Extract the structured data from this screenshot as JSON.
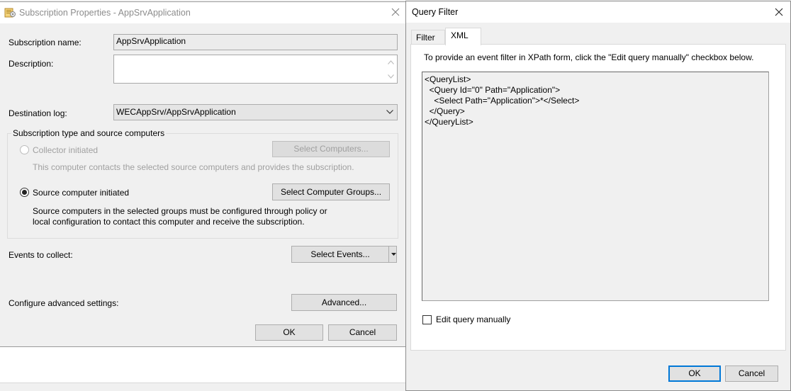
{
  "subscription_dialog": {
    "title": "Subscription Properties - AppSrvApplication",
    "name_label": "Subscription name:",
    "name_value": "AppSrvApplication",
    "description_label": "Description:",
    "description_value": "",
    "destination_label": "Destination log:",
    "destination_value": "WECAppSrv/AppSrvApplication",
    "group_title": "Subscription type and source computers",
    "collector_initiated": {
      "label": "Collector initiated",
      "button": "Select Computers...",
      "description": "This computer contacts the selected source computers and provides the subscription.",
      "selected": false,
      "enabled": false
    },
    "source_initiated": {
      "label": "Source computer initiated",
      "button": "Select Computer Groups...",
      "description_line1": "Source computers in the selected groups must be configured through policy or",
      "description_line2": "local configuration to contact this computer and receive the subscription.",
      "selected": true
    },
    "events_label": "Events to collect:",
    "events_button": "Select Events...",
    "advanced_label": "Configure advanced settings:",
    "advanced_button": "Advanced...",
    "ok_button": "OK",
    "cancel_button": "Cancel"
  },
  "query_filter_dialog": {
    "title": "Query Filter",
    "tabs": [
      {
        "label": "Filter",
        "active": false
      },
      {
        "label": "XML",
        "active": true
      }
    ],
    "instruction": "To provide an event filter in XPath form, click the \"Edit query manually\" checkbox below.",
    "xml_lines": [
      "<QueryList>",
      "  <Query Id=\"0\" Path=\"Application\">",
      "    <Select Path=\"Application\">*</Select>",
      "  </Query>",
      "</QueryList>"
    ],
    "edit_manually_label": "Edit query manually",
    "edit_manually_checked": false,
    "ok_button": "OK",
    "cancel_button": "Cancel"
  },
  "icons": {
    "app_icon": "subscription-properties-icon",
    "close": "close-icon",
    "dropdown": "chevron-down-icon"
  }
}
